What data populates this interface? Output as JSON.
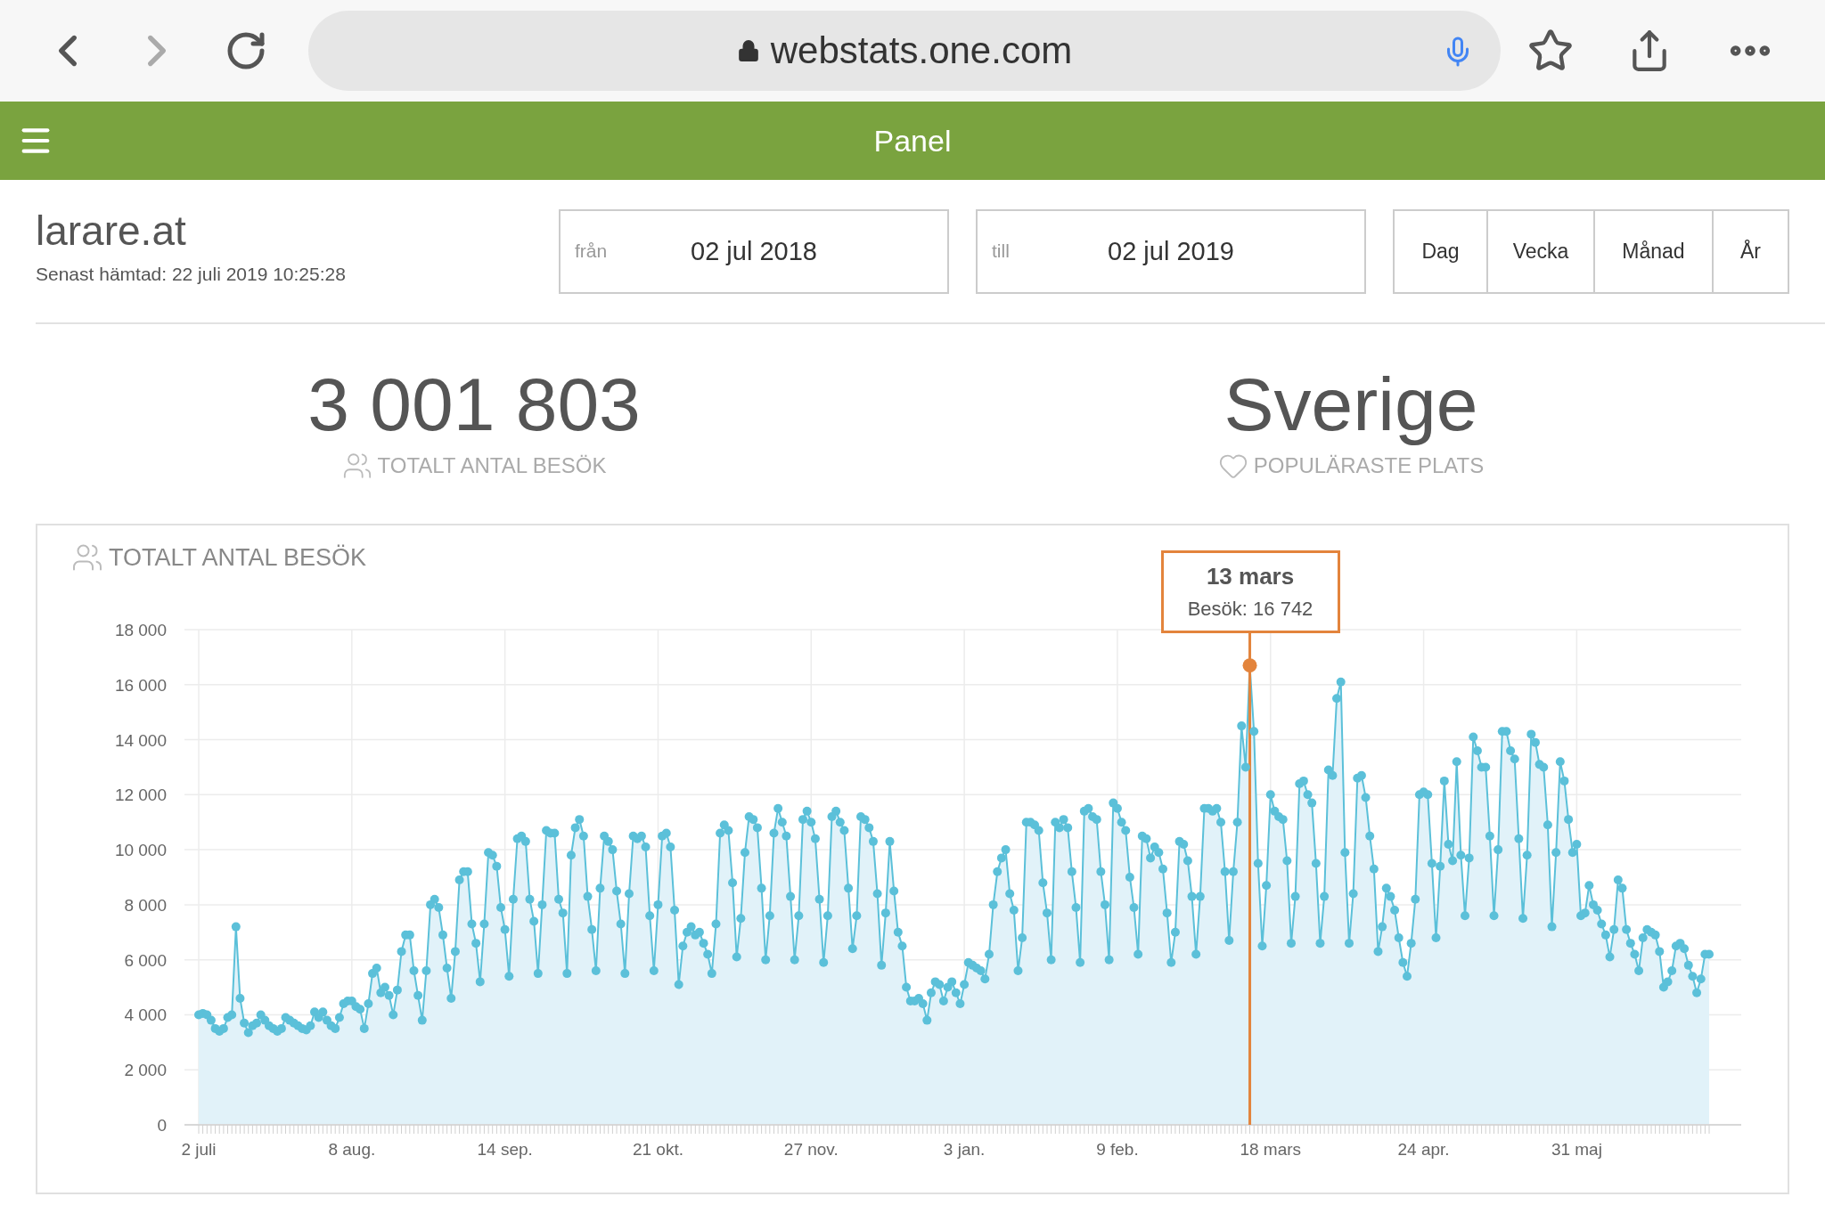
{
  "browser": {
    "url": "webstats.one.com"
  },
  "header": {
    "title": "Panel"
  },
  "site": {
    "name": "larare.at",
    "fetched": "Senast hämtad: 22 juli 2019 10:25:28"
  },
  "date_range": {
    "from": {
      "label": "från",
      "value": "02 jul 2018"
    },
    "to": {
      "label": "till",
      "value": "02 jul 2019"
    }
  },
  "periods": [
    {
      "label": "Dag"
    },
    {
      "label": "Vecka"
    },
    {
      "label": "Månad"
    },
    {
      "label": "År"
    }
  ],
  "stats": [
    {
      "kind": "visitors",
      "value": "3 001 803",
      "label": "TOTALT ANTAL BESÖK"
    },
    {
      "kind": "location",
      "value": "Sverige",
      "label": "POPULÄRASTE PLATS"
    }
  ],
  "chart": {
    "title": "TOTALT ANTAL BESÖK",
    "chart_data": {
      "type": "area",
      "grid": true,
      "ylim": [
        0,
        18000
      ],
      "yticks": [
        {
          "value": 0,
          "label": "0"
        },
        {
          "value": 2000,
          "label": "2 000"
        },
        {
          "value": 4000,
          "label": "4 000"
        },
        {
          "value": 6000,
          "label": "6 000"
        },
        {
          "value": 8000,
          "label": "8 000"
        },
        {
          "value": 10000,
          "label": "10 000"
        },
        {
          "value": 12000,
          "label": "12 000"
        },
        {
          "value": 14000,
          "label": "14 000"
        },
        {
          "value": 16000,
          "label": "16 000"
        },
        {
          "value": 18000,
          "label": "18 000"
        }
      ],
      "categories": [
        "2 juli",
        null,
        null,
        null,
        null,
        null,
        null,
        null,
        null,
        null,
        null,
        null,
        null,
        null,
        null,
        null,
        null,
        null,
        null,
        null,
        null,
        null,
        null,
        null,
        null,
        null,
        null,
        null,
        null,
        null,
        null,
        null,
        null,
        null,
        null,
        null,
        null,
        "8 aug.",
        null,
        null,
        null,
        null,
        null,
        null,
        null,
        null,
        null,
        null,
        null,
        null,
        null,
        null,
        null,
        null,
        null,
        null,
        null,
        null,
        null,
        null,
        null,
        null,
        null,
        null,
        null,
        null,
        null,
        null,
        null,
        null,
        null,
        null,
        null,
        null,
        "14 sep.",
        null,
        null,
        null,
        null,
        null,
        null,
        null,
        null,
        null,
        null,
        null,
        null,
        null,
        null,
        null,
        null,
        null,
        null,
        null,
        null,
        null,
        null,
        null,
        null,
        null,
        null,
        null,
        null,
        null,
        null,
        null,
        null,
        null,
        null,
        null,
        null,
        "21 okt.",
        null,
        null,
        null,
        null,
        null,
        null,
        null,
        null,
        null,
        null,
        null,
        null,
        null,
        null,
        null,
        null,
        null,
        null,
        null,
        null,
        null,
        null,
        null,
        null,
        null,
        null,
        null,
        null,
        null,
        null,
        null,
        null,
        null,
        null,
        null,
        null,
        "27 nov.",
        null,
        null,
        null,
        null,
        null,
        null,
        null,
        null,
        null,
        null,
        null,
        null,
        null,
        null,
        null,
        null,
        null,
        null,
        null,
        null,
        null,
        null,
        null,
        null,
        null,
        null,
        null,
        null,
        null,
        null,
        null,
        null,
        null,
        null,
        null,
        null,
        "3 jan.",
        null,
        null,
        null,
        null,
        null,
        null,
        null,
        null,
        null,
        null,
        null,
        null,
        null,
        null,
        null,
        null,
        null,
        null,
        null,
        null,
        null,
        null,
        null,
        null,
        null,
        null,
        null,
        null,
        null,
        null,
        null,
        null,
        null,
        null,
        null,
        null,
        "9 feb.",
        null,
        null,
        null,
        null,
        null,
        null,
        null,
        null,
        null,
        null,
        null,
        null,
        null,
        null,
        null,
        null,
        null,
        null,
        null,
        null,
        null,
        null,
        null,
        null,
        null,
        null,
        null,
        null,
        null,
        null,
        null,
        null,
        null,
        null,
        null,
        null,
        "18 mars",
        null,
        null,
        null,
        null,
        null,
        null,
        null,
        null,
        null,
        null,
        null,
        null,
        null,
        null,
        null,
        null,
        null,
        null,
        null,
        null,
        null,
        null,
        null,
        null,
        null,
        null,
        null,
        null,
        null,
        null,
        null,
        null,
        null,
        null,
        null,
        null,
        "24 apr.",
        null,
        null,
        null,
        null,
        null,
        null,
        null,
        null,
        null,
        null,
        null,
        null,
        null,
        null,
        null,
        null,
        null,
        null,
        null,
        null,
        null,
        null,
        null,
        null,
        null,
        null,
        null,
        null,
        null,
        null,
        null,
        null,
        null,
        null,
        null,
        null,
        "31 maj",
        null,
        null,
        null,
        null,
        null,
        null,
        null,
        null,
        null,
        null,
        null,
        null,
        null,
        null,
        null,
        null,
        null,
        null,
        null,
        null,
        null,
        null,
        null,
        null,
        null,
        null,
        null,
        null,
        null,
        null,
        null,
        null
      ],
      "series": [
        {
          "color": "#5bc0d9",
          "values": [
            4000,
            4050,
            4000,
            3800,
            3500,
            3400,
            3500,
            3900,
            4000,
            7200,
            4600,
            3700,
            3350,
            3600,
            3700,
            4000,
            3800,
            3600,
            3500,
            3400,
            3500,
            3900,
            3800,
            3700,
            3600,
            3500,
            3450,
            3600,
            4100,
            3900,
            4100,
            3800,
            3600,
            3500,
            3900,
            4400,
            4500,
            4500,
            4300,
            4200,
            3500,
            4400,
            5500,
            5700,
            4800,
            5000,
            4700,
            4000,
            4900,
            6300,
            6900,
            6900,
            5600,
            4700,
            3800,
            5600,
            8000,
            8200,
            7900,
            6900,
            5700,
            4600,
            6300,
            8900,
            9200,
            9200,
            7300,
            6600,
            5200,
            7300,
            9900,
            9800,
            9400,
            7900,
            7100,
            5400,
            8200,
            10400,
            10500,
            10300,
            8200,
            7400,
            5500,
            8000,
            10700,
            10600,
            10600,
            8200,
            7700,
            5500,
            9800,
            10800,
            11100,
            10500,
            8300,
            7100,
            5600,
            8600,
            10500,
            10300,
            10000,
            8500,
            7300,
            5500,
            8400,
            10500,
            10400,
            10500,
            10100,
            7600,
            5600,
            8000,
            10500,
            10600,
            10100,
            7800,
            5100,
            6500,
            7000,
            7200,
            6900,
            7000,
            6600,
            6200,
            5500,
            7300,
            10600,
            10900,
            10700,
            8800,
            6100,
            7500,
            9900,
            11200,
            11100,
            10800,
            8600,
            6000,
            7600,
            10600,
            11500,
            11000,
            10500,
            8300,
            6000,
            7600,
            11100,
            11400,
            11000,
            10400,
            8200,
            5900,
            7600,
            11200,
            11400,
            11000,
            10700,
            8600,
            6400,
            7600,
            11200,
            11100,
            10800,
            10300,
            8400,
            5800,
            7700,
            10300,
            8500,
            7000,
            6500,
            5000,
            4500,
            4500,
            4600,
            4400,
            3800,
            4800,
            5200,
            5100,
            4500,
            5000,
            5200,
            4800,
            4400,
            5100,
            5900,
            5800,
            5700,
            5600,
            5300,
            6200,
            8000,
            9200,
            9700,
            10000,
            8400,
            7800,
            5600,
            6800,
            11000,
            11000,
            10900,
            10700,
            8800,
            7700,
            6000,
            11000,
            10800,
            11100,
            10800,
            9200,
            7900,
            5900,
            11400,
            11500,
            11200,
            11100,
            9200,
            8000,
            6000,
            11700,
            11500,
            11000,
            10700,
            9000,
            7900,
            6200,
            10500,
            10400,
            9700,
            10100,
            9900,
            9300,
            7700,
            5900,
            7000,
            10300,
            10200,
            9600,
            8300,
            6200,
            8300,
            11500,
            11500,
            11400,
            11500,
            11000,
            9200,
            6700,
            9200,
            11000,
            14500,
            13000,
            16700,
            14300,
            9500,
            6500,
            8700,
            12000,
            11400,
            11200,
            11100,
            9600,
            6600,
            8300,
            12400,
            12500,
            12000,
            11700,
            9500,
            6600,
            8300,
            12900,
            12700,
            15500,
            16100,
            9900,
            6600,
            8400,
            12600,
            12700,
            11900,
            10500,
            9300,
            6300,
            7200,
            8600,
            8300,
            7800,
            6800,
            5900,
            5400,
            6600,
            8200,
            12000,
            12100,
            12000,
            9500,
            6800,
            9400,
            12500,
            10200,
            9600,
            13200,
            9800,
            7600,
            9700,
            14100,
            13600,
            13000,
            13000,
            10500,
            7600,
            10000,
            14300,
            14300,
            13600,
            13300,
            10400,
            7500,
            9800,
            14200,
            13900,
            13100,
            13000,
            10900,
            7200,
            9900,
            13200,
            12500,
            11100,
            9900,
            10200,
            7600,
            7700,
            8700,
            8000,
            7800,
            7300,
            6900,
            6100,
            7100,
            8900,
            8600,
            7100,
            6600,
            6200,
            5600,
            6800,
            7100,
            7000,
            6900,
            6300,
            5000,
            5200,
            5600,
            6500,
            6600,
            6400,
            5800,
            5400,
            4800,
            5300,
            6200,
            6200
          ]
        }
      ]
    },
    "tooltip": {
      "title": "13 mars",
      "label": "Besök: 16 742"
    }
  }
}
